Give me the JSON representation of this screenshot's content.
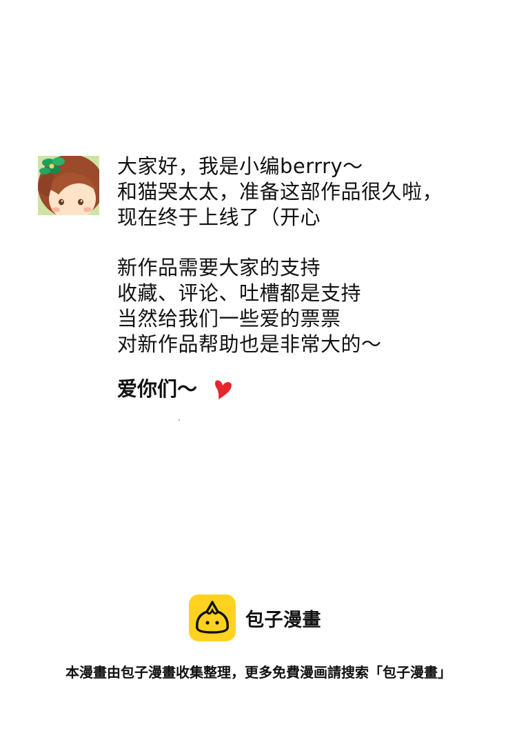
{
  "post": {
    "lines_1": [
      "大家好，我是小编berrry～",
      "和猫哭太太，准备这部作品很久啦，",
      "现在终于上线了（开心"
    ],
    "lines_2": [
      "新作品需要大家的支持",
      "收藏、评论、吐槽都是支持",
      "当然给我们一些爱的票票",
      "对新作品帮助也是非常大的～"
    ],
    "love_text": "爱你们～"
  },
  "brand": {
    "name": "包子漫畫",
    "color": "#ffd21f"
  },
  "footer": {
    "note": "本漫畫由包子漫畫收集整理，更多免費漫画請搜索「包子漫畫」"
  },
  "colors": {
    "heart": "#e5262d",
    "text": "#111111"
  }
}
